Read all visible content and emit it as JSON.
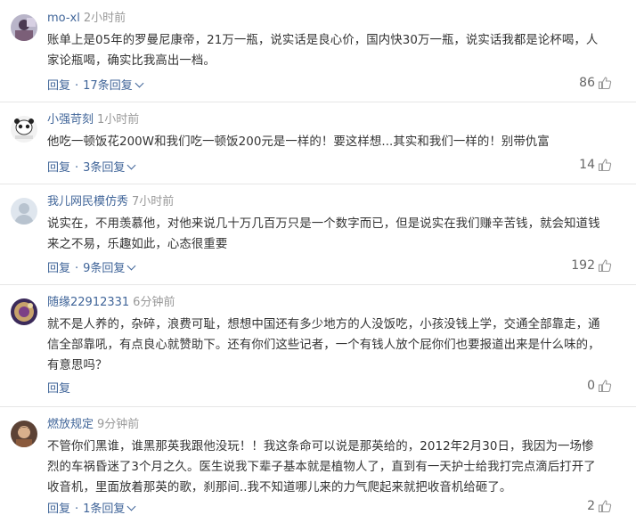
{
  "comments": [
    {
      "user": "mo-xl",
      "time": "2小时前",
      "text": "账单上是05年的罗曼尼康帝，21万一瓶，说实话是良心价，国内快30万一瓶，说实话我都是论杯喝，人家论瓶喝，确实比我高出一档。",
      "reply_label": "回复",
      "replies_label": "17条回复",
      "likes": "86"
    },
    {
      "user": "小强苛刻",
      "time": "1小时前",
      "text": "他吃一顿饭花200W和我们吃一顿饭200元是一样的！要这样想...其实和我们一样的！别带仇富",
      "reply_label": "回复",
      "replies_label": "3条回复",
      "likes": "14"
    },
    {
      "user": "我儿网民模仿秀",
      "time": "7小时前",
      "text": "说实在，不用羡慕他，对他来说几十万几百万只是一个数字而已，但是说实在我们赚辛苦钱，就会知道钱来之不易，乐趣如此，心态很重要",
      "reply_label": "回复",
      "replies_label": "9条回复",
      "likes": "192"
    },
    {
      "user": "随缘22912331",
      "time": "6分钟前",
      "text": "就不是人养的，杂碎，浪费可耻，想想中国还有多少地方的人没饭吃，小孩没钱上学，交通全部靠走，通信全部靠吼，有点良心就赞助下。还有你们这些记者，一个有钱人放个屁你们也要报道出来是什么味的，有意思吗？",
      "reply_label": "回复",
      "replies_label": "",
      "likes": "0"
    },
    {
      "user": "燃放规定",
      "time": "9分钟前",
      "text": "不管你们黑谁，谁黑那英我跟他没玩！！我这条命可以说是那英给的，2012年2月30日，我因为一场惨烈的车祸昏迷了3个月之久。医生说我下辈子基本就是植物人了，直到有一天护士给我打完点滴后打开了收音机，里面放着那英的歌，刹那间..我不知道哪儿来的力气爬起来就把收音机给砸了。",
      "reply_label": "回复",
      "replies_label": "1条回复",
      "likes": "2"
    }
  ]
}
